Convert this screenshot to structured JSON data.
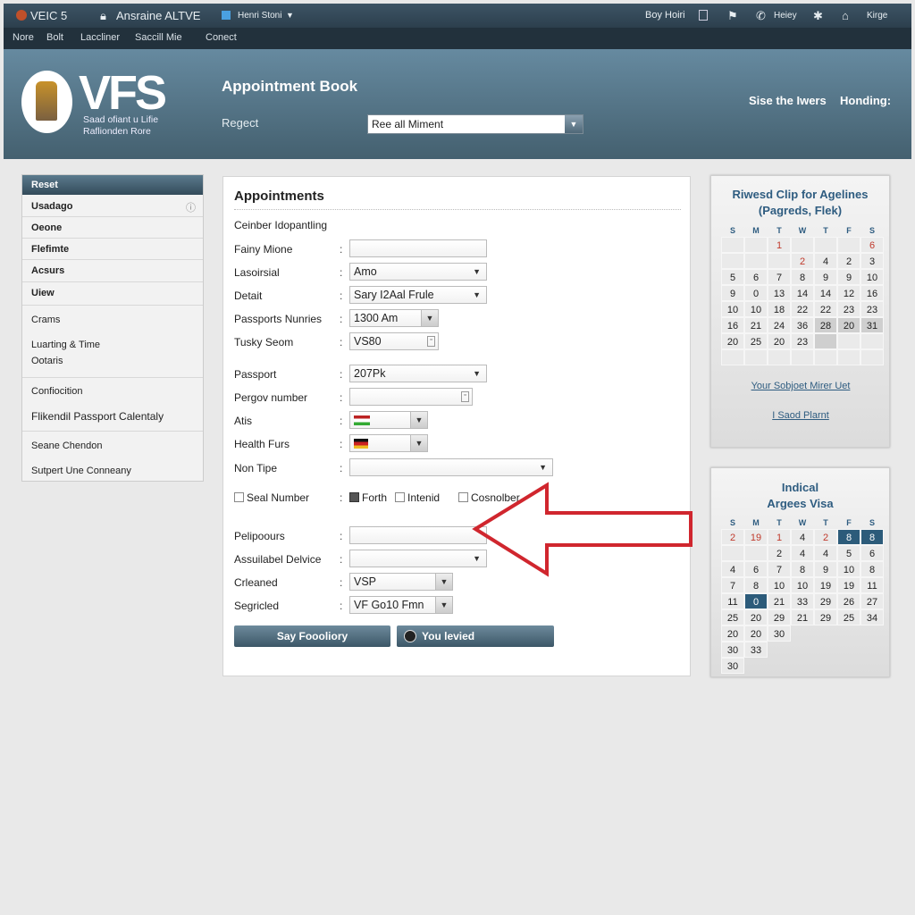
{
  "topbar": {
    "brand": "VEIC 5",
    "lock_label": "Ansraine ALTVE",
    "menu": "Henri Stoni",
    "right": [
      "Boy Hoiri",
      "Heiey",
      "Kirge"
    ]
  },
  "navbar": {
    "items": [
      "Nore",
      "Bolt",
      "Laccliner",
      "Saccill Mie",
      "Conect"
    ]
  },
  "header": {
    "logo": "VFS",
    "logo_sub1": "Saad ofiant u Lifie",
    "logo_sub2": "Raflionden Rore",
    "title": "Appointment Book",
    "select_label": "Regect",
    "select_value": "Ree all Miment",
    "right1": "Sise the Iwers",
    "right2": "Honding:"
  },
  "sidebar": {
    "head": "Reset",
    "items": [
      "Usadago",
      "Oeone",
      "Flefimte",
      "Acsurs",
      "Uiew",
      "Crams",
      "Luarting & Time",
      "Ootaris",
      "Confiocition",
      "Flikendil Passport Calentaly",
      "Seane Chendon",
      "Sutpert Une Conneany"
    ]
  },
  "form": {
    "title": "Appointments",
    "section": "Ceinber Idopantling",
    "rows": [
      {
        "label": "Fainy Mione",
        "value": ""
      },
      {
        "label": "Lasoirsial",
        "value": "Amo"
      },
      {
        "label": "Detait",
        "value": "Sary I2Aal Frule"
      },
      {
        "label": "Passports Nunries",
        "value": "1300 Am"
      },
      {
        "label": "Tusky Seom",
        "value": "VS80"
      },
      {
        "label": "Passport",
        "value": "207Pk"
      },
      {
        "label": "Pergov number",
        "value": ""
      },
      {
        "label": "Atis",
        "value": ""
      },
      {
        "label": "Health Furs",
        "value": ""
      },
      {
        "label": "Non Tipe",
        "value": ""
      },
      {
        "label": "Pelipoours",
        "value": ""
      },
      {
        "label": "Assuilabel Delvice",
        "value": ""
      },
      {
        "label": "Crleaned",
        "value": "VSP"
      },
      {
        "label": "Segricled",
        "value": "VF Go10 Fmn"
      }
    ],
    "checkbox_label": "Seal Number",
    "options": [
      {
        "label": "Forth",
        "checked": true
      },
      {
        "label": "Intenid",
        "checked": false
      },
      {
        "label": "Cosnolber",
        "checked": false
      }
    ],
    "button1": "Say Foooliory",
    "button2": "You levied"
  },
  "calendar1": {
    "title1": "Riwesd Clip for Agelines",
    "title2": "(Pagreds, Flek)",
    "days": [
      "S",
      "M",
      "T",
      "W",
      "T",
      "F",
      "S"
    ],
    "rows": [
      [
        "",
        "",
        "1",
        "",
        "",
        "",
        "6"
      ],
      [
        "",
        "",
        "",
        "2",
        "4",
        "2",
        "3"
      ],
      [
        "5",
        "6",
        "7",
        "8",
        "9",
        "9",
        "10"
      ],
      [
        "9",
        "0",
        "13",
        "14",
        "14",
        "12",
        "16"
      ],
      [
        "10",
        "10",
        "18",
        "22",
        "22",
        "23",
        "23"
      ],
      [
        "16",
        "21",
        "24",
        "36",
        "28",
        "20",
        "31"
      ],
      [
        "20",
        "25",
        "20",
        "23",
        "",
        "",
        ""
      ],
      [
        "",
        "",
        "",
        "",
        "",
        "",
        ""
      ]
    ],
    "link1": "Your Sobjoet Mirer Uet",
    "link2": "I Saod Plarnt"
  },
  "calendar2": {
    "title1": "Indical",
    "title2": "Argees Visa",
    "days": [
      "S",
      "M",
      "T",
      "W",
      "T",
      "F",
      "S"
    ],
    "rows": [
      [
        "2",
        "19",
        "1",
        "4",
        "2",
        "8",
        "8"
      ],
      [
        "",
        "",
        "2",
        "4",
        "4",
        "5",
        "6"
      ],
      [
        "4",
        "6",
        "7",
        "8",
        "9",
        "10",
        "8"
      ],
      [
        "7",
        "8",
        "10",
        "10",
        "19",
        "19",
        "11"
      ],
      [
        "11",
        "0",
        "21",
        "33",
        "29",
        "26",
        "27"
      ],
      [
        "25",
        "20",
        "29",
        "21",
        "29",
        "25",
        "34"
      ],
      [
        "20",
        "20",
        "30"
      ],
      [
        "30",
        "33"
      ],
      [
        "30"
      ]
    ],
    "selected": "0"
  },
  "colors": {
    "accent": "#2c5b7a",
    "arrow": "#d0262e",
    "header": "#5a7d92"
  }
}
